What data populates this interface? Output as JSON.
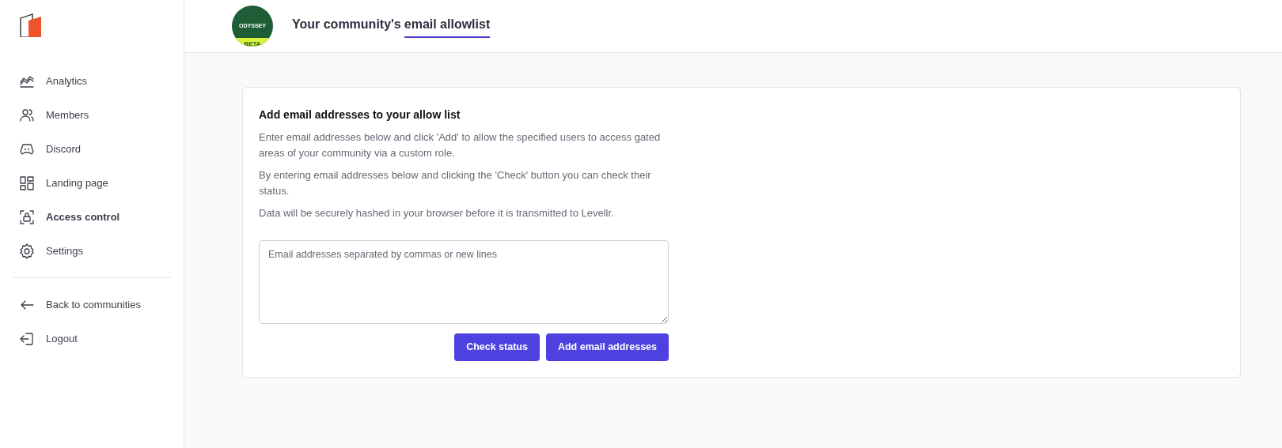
{
  "sidebar": {
    "items": [
      {
        "kind": "analytics",
        "label": "Analytics",
        "selected": false
      },
      {
        "kind": "members",
        "label": "Members",
        "selected": false
      },
      {
        "kind": "discord",
        "label": "Discord",
        "selected": false
      },
      {
        "kind": "landing",
        "label": "Landing page",
        "selected": false
      },
      {
        "kind": "access",
        "label": "Access control",
        "selected": true
      },
      {
        "kind": "settings",
        "label": "Settings",
        "selected": false
      }
    ],
    "footer_items": [
      {
        "kind": "back",
        "label": "Back to communities"
      },
      {
        "kind": "logout",
        "label": "Logout"
      }
    ]
  },
  "header": {
    "community_logo": {
      "name": "ODYSSEY",
      "badge": "BETA"
    },
    "title": "Your community's",
    "tabs": [
      {
        "label": "email allowlist",
        "selected": true
      }
    ]
  },
  "card": {
    "title": "Add email addresses to your allow list",
    "paragraphs": [
      "Enter email addresses below and click 'Add' to allow the specified users to access gated areas of your community via a custom role.",
      "By entering email addresses below and clicking the 'Check' button you can check their status.",
      "Data will be securely hashed in your browser before it is transmitted to Levellr."
    ],
    "textarea": {
      "placeholder": "Email addresses separated by commas or new lines"
    },
    "buttons": [
      "Check status",
      "Add email addresses"
    ]
  }
}
